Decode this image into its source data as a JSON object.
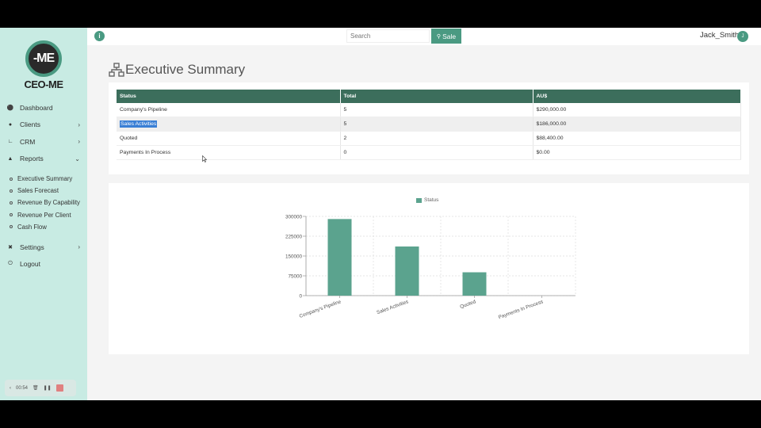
{
  "sidebar": {
    "logo_mark": "-ME",
    "logo_text": "CEO-ME",
    "items": [
      {
        "label": "Dashboard",
        "icon": "home-icon",
        "chevron": ""
      },
      {
        "label": "Clients",
        "icon": "users-icon",
        "chevron": "›"
      },
      {
        "label": "CRM",
        "icon": "chart-line-icon",
        "chevron": "›"
      },
      {
        "label": "Reports",
        "icon": "bell-icon",
        "chevron": "⌄"
      }
    ],
    "report_items": [
      "Executive Summary",
      "Sales Forecast",
      "Revenue By Capability",
      "Revenue Per Client",
      "Cash Flow"
    ],
    "settings_label": "Settings",
    "settings_chevron": "›",
    "logout_label": "Logout"
  },
  "recorder": {
    "time": "00:54"
  },
  "header": {
    "search_placeholder": "Search",
    "sale_label": "Sale",
    "user_name": "Jack_Smith",
    "avatar_initial": "J"
  },
  "page_title": "Executive Summary",
  "table": {
    "headers": [
      "Status",
      "Total",
      "AU$"
    ],
    "rows": [
      [
        "Company's Pipeline",
        "5",
        "$290,000.00"
      ],
      [
        "Sales Activities",
        "5",
        "$186,000.00"
      ],
      [
        "Quoted",
        "2",
        "$88,400.00"
      ],
      [
        "Payments In Process",
        "0",
        "$0.00"
      ]
    ]
  },
  "colors": {
    "accent": "#4a9a82",
    "header": "#3c6e5c",
    "bar": "#5ba38e",
    "sidebar": "#c8ebe3"
  },
  "chart_data": {
    "type": "bar",
    "categories": [
      "Company's Pipeline",
      "Sales Activities",
      "Quoted",
      "Payments In Process"
    ],
    "series": [
      {
        "name": "Status",
        "values": [
          290000,
          186000,
          88400,
          0
        ]
      }
    ],
    "yticks": [
      "0",
      "75000",
      "150000",
      "225000",
      "300000"
    ],
    "ylim": [
      0,
      300000
    ],
    "legend": "top-center",
    "grid": true
  }
}
